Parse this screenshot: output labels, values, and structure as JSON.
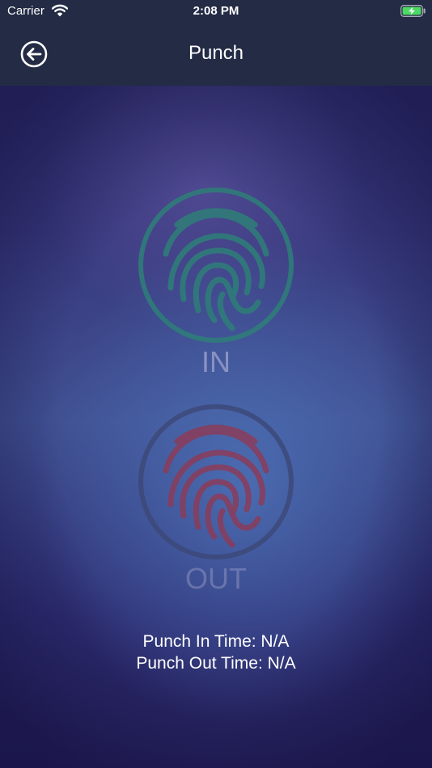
{
  "status_bar": {
    "carrier": "Carrier",
    "time": "2:08 PM",
    "wifi_icon": "wifi-icon",
    "battery_icon": "battery-charging-icon"
  },
  "nav": {
    "title": "Punch",
    "back_icon": "back-arrow-circle-icon"
  },
  "punch_in": {
    "label": "IN",
    "icon": "fingerprint-icon",
    "color": "#2e7f78"
  },
  "punch_out": {
    "label": "OUT",
    "icon": "fingerprint-icon",
    "color": "#8a3c5a"
  },
  "times": {
    "punch_in_time": "Punch In Time: N/A",
    "punch_out_time": "Punch Out Time: N/A"
  },
  "colors": {
    "header_bg": "#232b45",
    "background": "#2b2a63"
  }
}
